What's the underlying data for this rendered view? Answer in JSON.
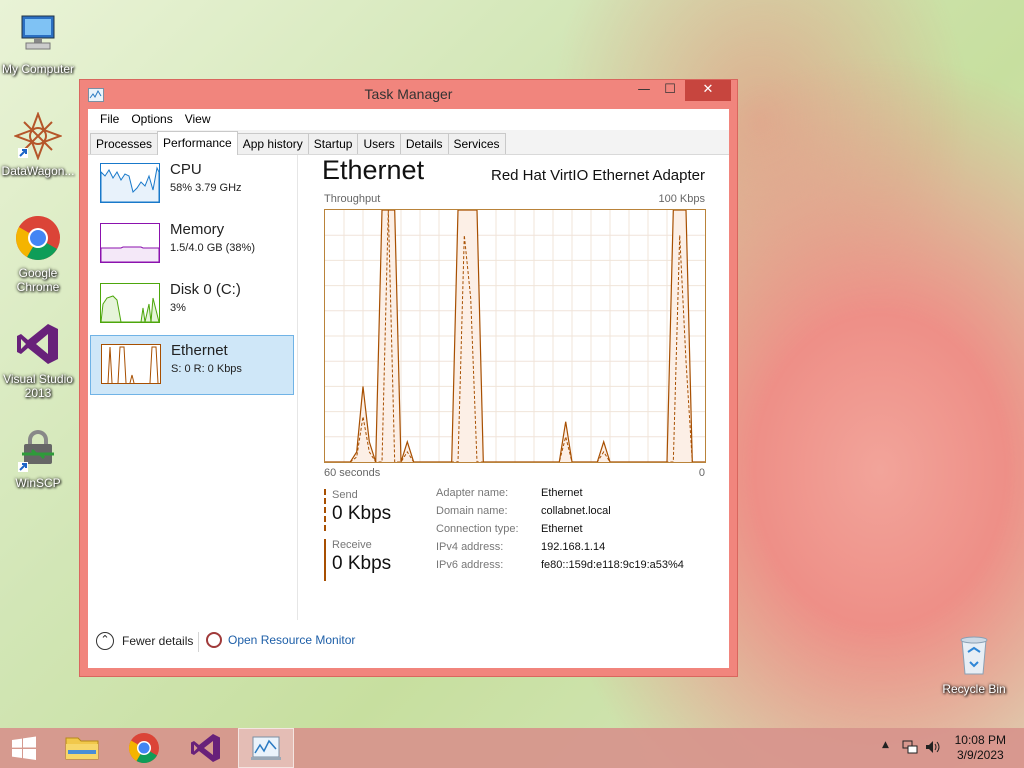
{
  "desktop": {
    "icons": [
      {
        "label": "My Computer"
      },
      {
        "label": "DataWagon..."
      },
      {
        "label": "Google Chrome"
      },
      {
        "label": "Visual Studio 2013"
      },
      {
        "label": "WinSCP"
      },
      {
        "label": "Recycle Bin"
      }
    ]
  },
  "window": {
    "title": "Task Manager",
    "controls": {
      "minimize": "—",
      "maximize": "☐",
      "close": "✕"
    },
    "menu": [
      "File",
      "Options",
      "View"
    ],
    "tabs": [
      "Processes",
      "Performance",
      "App history",
      "Startup",
      "Users",
      "Details",
      "Services"
    ],
    "active_tab": "Performance"
  },
  "sidebar": {
    "items": [
      {
        "name": "CPU",
        "sub": "58%  3.79 GHz",
        "color": "#1979ca"
      },
      {
        "name": "Memory",
        "sub": "1.5/4.0 GB (38%)",
        "color": "#8b12ae"
      },
      {
        "name": "Disk 0 (C:)",
        "sub": "3%",
        "color": "#4da60c"
      },
      {
        "name": "Ethernet",
        "sub": "S: 0 R: 0 Kbps",
        "color": "#a74f01"
      }
    ],
    "selected": "Ethernet"
  },
  "detail": {
    "heading": "Ethernet",
    "adapter": "Red Hat VirtIO Ethernet Adapter",
    "throughput_label": "Throughput",
    "max_label": "100 Kbps",
    "time_label": "60 seconds",
    "zero_label": "0",
    "send": {
      "label": "Send",
      "value": "0 Kbps"
    },
    "receive": {
      "label": "Receive",
      "value": "0 Kbps"
    },
    "properties": [
      {
        "key": "Adapter name:",
        "value": "Ethernet"
      },
      {
        "key": "Domain name:",
        "value": "collabnet.local"
      },
      {
        "key": "Connection type:",
        "value": "Ethernet"
      },
      {
        "key": "IPv4 address:",
        "value": "192.168.1.14"
      },
      {
        "key": "IPv6 address:",
        "value": "fe80::159d:e118:9c19:a53%4"
      }
    ]
  },
  "footer": {
    "fewer_details": "Fewer details",
    "open_resource_monitor": "Open Resource Monitor"
  },
  "chart_data": {
    "type": "area",
    "title": "Throughput",
    "xlabel": "60 seconds",
    "ylabel": "",
    "xlim": [
      60,
      0
    ],
    "ylim": [
      0,
      100
    ],
    "x": [
      60,
      59,
      58,
      57,
      56,
      55,
      54,
      53,
      52,
      51,
      50,
      49,
      48,
      47,
      46,
      45,
      44,
      43,
      42,
      41,
      40,
      39,
      38,
      37,
      36,
      35,
      34,
      33,
      32,
      31,
      30,
      29,
      28,
      27,
      26,
      25,
      24,
      23,
      22,
      21,
      20,
      19,
      18,
      17,
      16,
      15,
      14,
      13,
      12,
      11,
      10,
      9,
      8,
      7,
      6,
      5,
      4,
      3,
      2,
      1,
      0
    ],
    "series": [
      {
        "values": [
          0,
          0,
          0,
          0,
          0,
          4,
          30,
          8,
          0,
          100,
          100,
          100,
          0,
          8,
          0,
          0,
          0,
          0,
          0,
          0,
          0,
          100,
          100,
          100,
          100,
          0,
          0,
          0,
          0,
          0,
          0,
          0,
          0,
          0,
          0,
          0,
          0,
          0,
          16,
          0,
          0,
          0,
          0,
          0,
          8,
          0,
          0,
          0,
          0,
          0,
          0,
          0,
          0,
          0,
          0,
          100,
          100,
          100,
          0,
          0,
          0
        ],
        "style": "solid"
      },
      {
        "values": [
          0,
          0,
          0,
          0,
          0,
          2,
          18,
          4,
          0,
          0,
          100,
          0,
          0,
          4,
          0,
          0,
          0,
          0,
          0,
          0,
          0,
          0,
          90,
          65,
          0,
          0,
          0,
          0,
          0,
          0,
          0,
          0,
          0,
          0,
          0,
          0,
          0,
          0,
          10,
          0,
          0,
          0,
          0,
          0,
          4,
          0,
          0,
          0,
          0,
          0,
          0,
          0,
          0,
          0,
          0,
          0,
          90,
          40,
          0,
          0,
          0
        ],
        "style": "dashed"
      }
    ],
    "colors": {
      "line": "#a74f01",
      "fill": "#fcefe6",
      "grid": "#f0e4da"
    }
  },
  "taskbar": {
    "apps": [
      "start",
      "file-explorer",
      "chrome",
      "visual-studio",
      "task-manager"
    ],
    "time": "10:08 PM",
    "date": "3/9/2023"
  }
}
